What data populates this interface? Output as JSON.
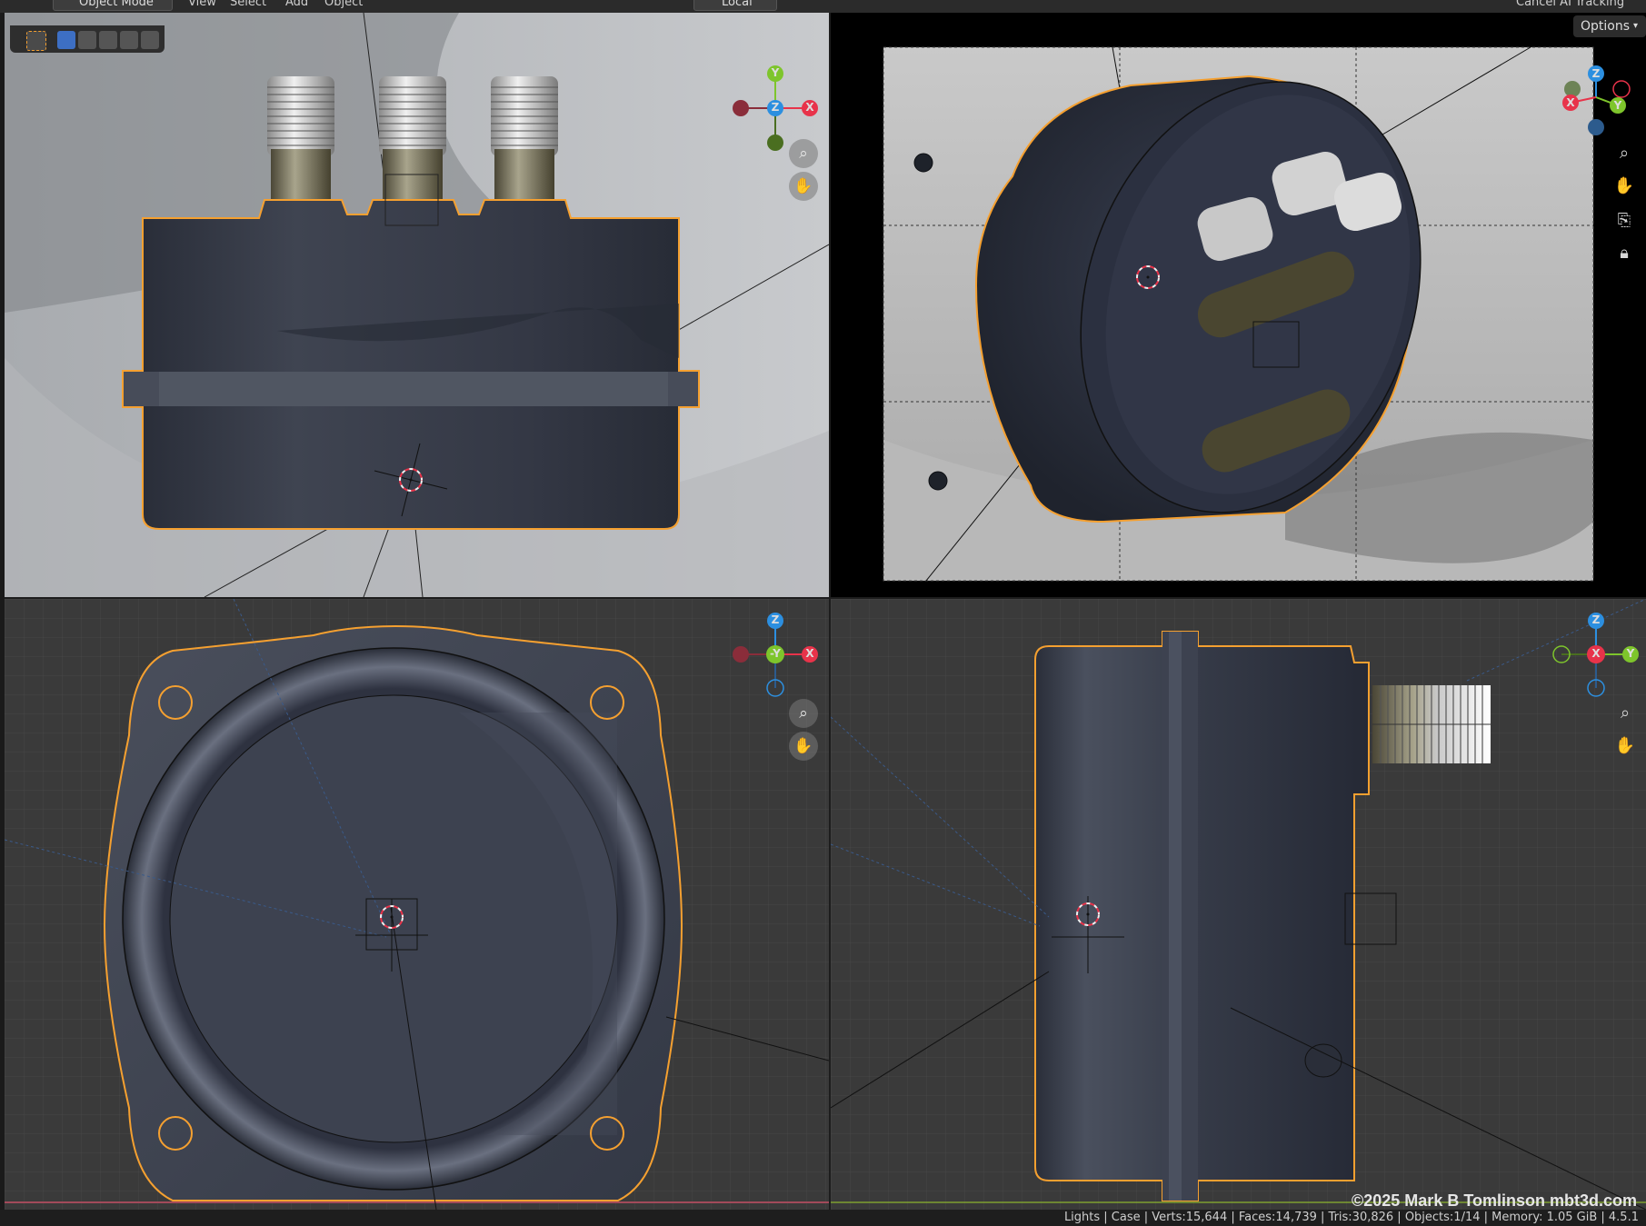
{
  "header": {
    "mode": "Object Mode",
    "menus": [
      "View",
      "Select",
      "Add",
      "Object"
    ],
    "transform_orientation": "Local",
    "render_engine_menu": "Cancel AI Tracking"
  },
  "camera_viewport": {
    "options_label": "Options"
  },
  "gizmo_labels": {
    "top_left": {
      "up": "Y",
      "center": "Z",
      "right": "X"
    },
    "top_right": {
      "up": "Z",
      "left": "X",
      "right": "Y"
    },
    "bottom_left": {
      "up": "Z",
      "center": "-Y",
      "right": "X"
    },
    "bottom_right": {
      "up": "Z",
      "center": "X",
      "right": "Y"
    }
  },
  "watermark": "©2025 Mark B Tomlinson mbt3d.com",
  "status_bar": "Lights | Case | Verts:15,644 | Faces:14,739 | Tris:30,826 | Objects:1/14 | Memory: 1.05 GiB | 4.5.1",
  "colors": {
    "selection_outline": "#f5a030",
    "axis_x": "#e8334a",
    "axis_y": "#7ec52c",
    "axis_z": "#2c8fe0",
    "model_body": "#3a3f4c"
  },
  "icons": [
    "select-box-icon",
    "zoom-icon",
    "hand-pan-icon",
    "camera-view-icon",
    "lock-icon",
    "chevron-down-icon"
  ]
}
